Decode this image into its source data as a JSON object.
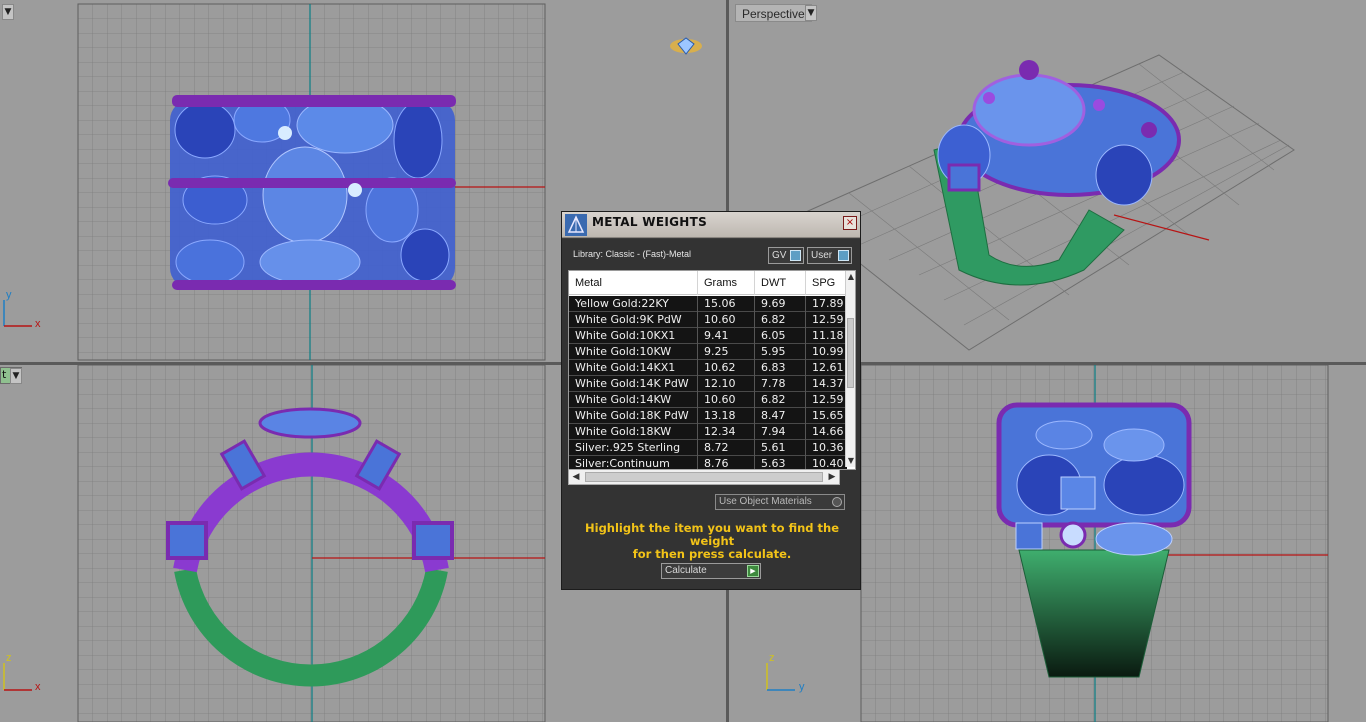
{
  "viewports": {
    "perspective_label": "Perspective",
    "bottom_left_label": "t",
    "top_axes": {
      "v": "y",
      "h": "x"
    },
    "left_axes": {
      "v": "z",
      "h": "x"
    },
    "right_axes": {
      "v": "z",
      "h": "y"
    }
  },
  "dialog": {
    "title": "METAL WEIGHTS",
    "library": "Library: Classic - (Fast)-Metal",
    "toggle_gv": "GV",
    "toggle_user": "User",
    "columns": [
      "Metal",
      "Grams",
      "DWT",
      "SPG"
    ],
    "rows": [
      [
        "Yellow Gold:22KY",
        "15.06",
        "9.69",
        "17.89"
      ],
      [
        "White Gold:9K PdW",
        "10.60",
        "6.82",
        "12.59"
      ],
      [
        "White Gold:10KX1",
        "9.41",
        "6.05",
        "11.18"
      ],
      [
        "White Gold:10KW",
        "9.25",
        "5.95",
        "10.99"
      ],
      [
        "White Gold:14KX1",
        "10.62",
        "6.83",
        "12.61"
      ],
      [
        "White Gold:14K PdW",
        "12.10",
        "7.78",
        "14.37"
      ],
      [
        "White Gold:14KW",
        "10.60",
        "6.82",
        "12.59"
      ],
      [
        "White Gold:18K PdW",
        "13.18",
        "8.47",
        "15.65"
      ],
      [
        "White Gold:18KW",
        "12.34",
        "7.94",
        "14.66"
      ],
      [
        "Silver:.925 Sterling",
        "8.72",
        "5.61",
        "10.36"
      ],
      [
        "Silver:Continuum",
        "8.76",
        "5.63",
        "10.40"
      ]
    ],
    "use_object_materials": "Use Object Materials",
    "hint_line1": "Highlight the item you want to find the weight",
    "hint_line2": "for then press calculate.",
    "calculate": "Calculate",
    "close": "×"
  },
  "colors": {
    "hint": "#f2c318",
    "stone_blue": "#4a74d8",
    "metal_purple": "#7a2bb0",
    "shank_green": "#2e9a5a"
  }
}
